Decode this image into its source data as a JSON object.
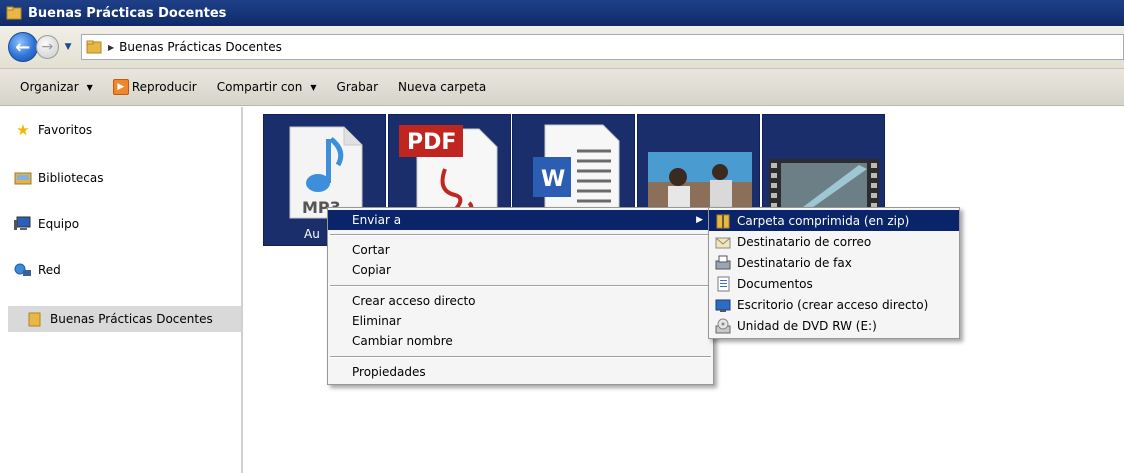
{
  "window": {
    "title": "Buenas Prácticas Docentes"
  },
  "address": {
    "path": "Buenas Prácticas Docentes"
  },
  "toolbar": {
    "organize": "Organizar",
    "play": "Reproducir",
    "share": "Compartir con",
    "burn": "Grabar",
    "new_folder": "Nueva carpeta"
  },
  "nav": {
    "favorites": "Favoritos",
    "libraries": "Bibliotecas",
    "computer": "Equipo",
    "network": "Red",
    "current_folder": "Buenas Prácticas Docentes"
  },
  "files": {
    "audio_label": "Au",
    "pdf_text": "PDF",
    "word_text": "W",
    "mp3_text": "MP3"
  },
  "context_menu": {
    "send_to": "Enviar a",
    "cut": "Cortar",
    "copy": "Copiar",
    "create_shortcut": "Crear acceso directo",
    "delete": "Eliminar",
    "rename": "Cambiar nombre",
    "properties": "Propiedades"
  },
  "send_to_menu": {
    "compressed": "Carpeta comprimida (en zip)",
    "mail": "Destinatario de correo",
    "fax": "Destinatario de fax",
    "documents": "Documentos",
    "desktop": "Escritorio (crear acceso directo)",
    "dvd": "Unidad de DVD RW (E:)"
  }
}
